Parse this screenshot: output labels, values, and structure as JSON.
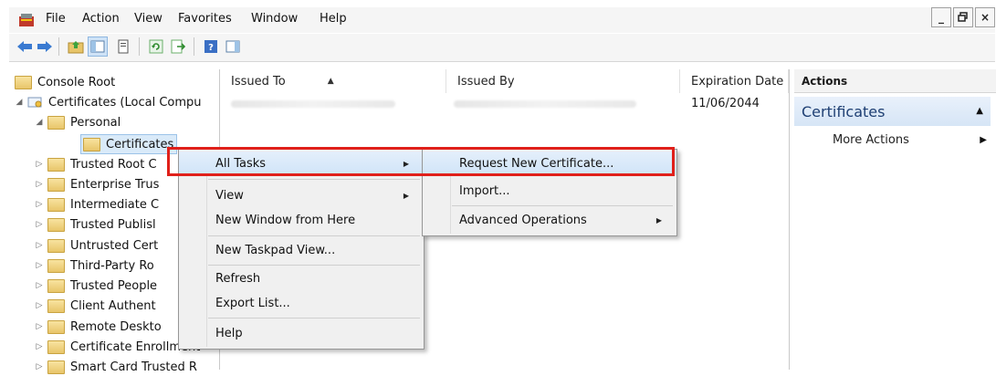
{
  "menubar": {
    "items": [
      "File",
      "Action",
      "View",
      "Favorites",
      "Window",
      "Help"
    ]
  },
  "window_controls": [
    "_",
    "Б",
    "×"
  ],
  "tree": {
    "items": [
      {
        "label": "Console Root"
      },
      {
        "label": "Certificates (Local Compu"
      },
      {
        "label": "Personal"
      },
      {
        "label": "Certificates"
      },
      {
        "label": "Trusted Root C"
      },
      {
        "label": "Enterprise Trus"
      },
      {
        "label": "Intermediate C"
      },
      {
        "label": "Trusted Publisl"
      },
      {
        "label": "Untrusted Cert"
      },
      {
        "label": "Third-Party Ro"
      },
      {
        "label": "Trusted People"
      },
      {
        "label": "Client Authent"
      },
      {
        "label": "Remote Deskto"
      },
      {
        "label": "Certificate Enrollment"
      },
      {
        "label": "Smart Card Trusted R"
      }
    ]
  },
  "list": {
    "columns": [
      "Issued To",
      "Issued By",
      "Expiration Date"
    ],
    "rows": [
      {
        "expiration": "11/06/2044"
      }
    ]
  },
  "actions": {
    "header": "Actions",
    "section": "Certificates",
    "more": "More Actions"
  },
  "context_menu": {
    "items": [
      "All Tasks",
      "View",
      "New Window from Here",
      "New Taskpad View...",
      "Refresh",
      "Export List...",
      "Help"
    ]
  },
  "submenu": {
    "items": [
      "Request New Certificate...",
      "Import...",
      "Advanced Operations"
    ]
  },
  "colors": {
    "highlight_border": "#e0201a",
    "selection": "#d0e4f8",
    "actions_title": "#1e3f73"
  }
}
